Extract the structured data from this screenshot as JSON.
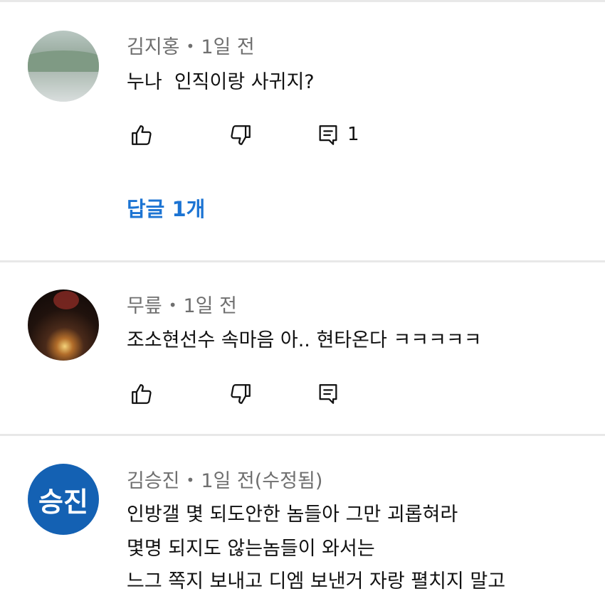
{
  "comments": [
    {
      "author": "김지홍",
      "time": "1일 전",
      "lines": [
        "누나  인직이랑 사귀지?"
      ],
      "reply_count": "1",
      "replies_link": "답글 1개"
    },
    {
      "author": "무릎",
      "time": "1일 전",
      "lines": [
        "조소현선수 속마음 아.. 현타온다 ㅋㅋㅋㅋㅋ"
      ]
    },
    {
      "author": "김승진",
      "time": "1일 전(수정됨)",
      "avatar_text": "승진",
      "lines": [
        "인방갤 몇 되도안한 놈들아 그만 괴롭혀라",
        "몇명 되지도 않는놈들이 와서는",
        "느그 쪽지 보내고 디엠 보낸거 자랑 펼치지 말고"
      ]
    }
  ],
  "separator": "•",
  "icons": {
    "like": "thumbs-up-icon",
    "dislike": "thumbs-down-icon",
    "reply": "comment-icon"
  },
  "colors": {
    "link": "#1c74d3",
    "meta": "#6f6f6f",
    "avatar_bg": "#1461b3"
  }
}
